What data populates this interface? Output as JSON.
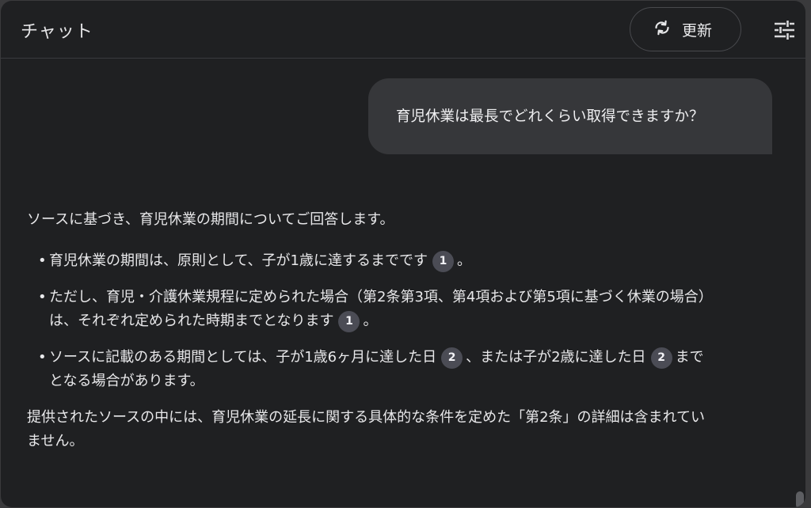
{
  "header": {
    "title": "チャット",
    "refresh_label": "更新"
  },
  "conversation": {
    "user_message": "育児休業は最長でどれくらい取得できますか？",
    "reply": {
      "intro": "ソースに基づき、育児休業の期間についてご回答します。",
      "bullets": [
        {
          "t1": "育児休業の期間は、原則として、子が1歳に達するまでです",
          "c1": "1",
          "t2": "。"
        },
        {
          "t1": "ただし、育児・介護休業規程に定められた場合（第2条第3項、第4項および第5項に基づく休業の場合）は、それぞれ定められた時期までとなります",
          "c1": "1",
          "t2": "。"
        },
        {
          "t1": "ソースに記載のある期間としては、子が1歳6ヶ月に達した日",
          "c1": "2",
          "t2": "、または子が2歳に達した日",
          "c2": "2",
          "t3": "までとなる場合があります。"
        }
      ],
      "outro": "提供されたソースの中には、育児休業の延長に関する具体的な条件を定めた「第2条」の詳細は含まれていません。"
    }
  },
  "colors": {
    "panel_bg": "#1f2022",
    "user_bubble_bg": "#36373a",
    "citation_bg": "#4b4c55"
  },
  "icons": {
    "refresh": "refresh-icon",
    "settings": "tune-icon"
  }
}
